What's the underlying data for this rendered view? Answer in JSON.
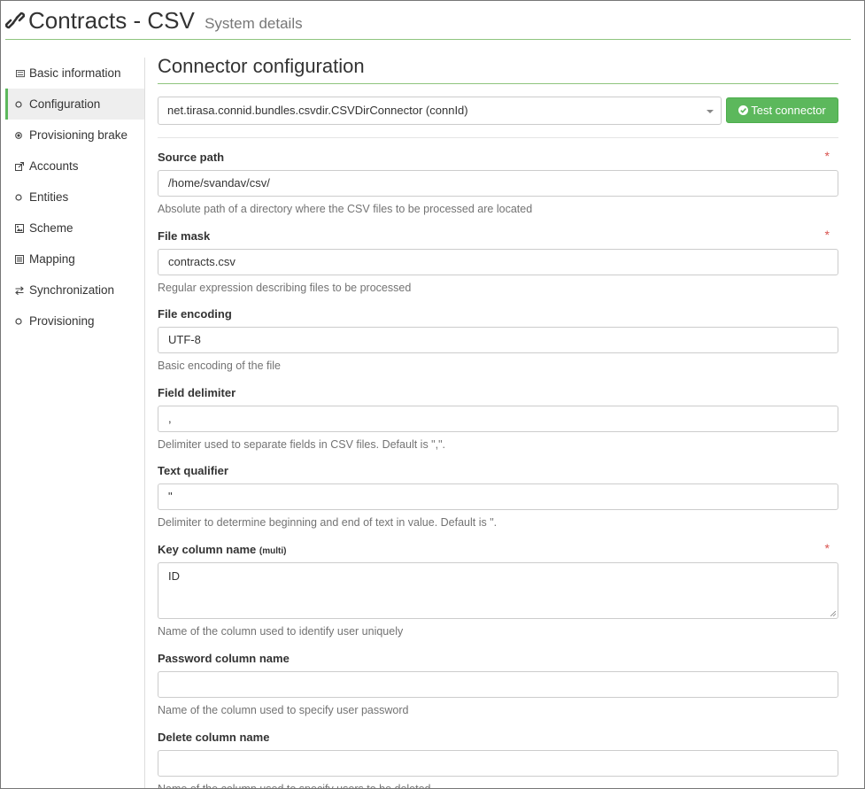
{
  "header": {
    "title": "Contracts - CSV",
    "subtitle": "System details"
  },
  "sidebar": {
    "items": [
      {
        "label": "Basic information",
        "icon": "list-icon",
        "active": false
      },
      {
        "label": "Configuration",
        "icon": "circle-icon",
        "active": true
      },
      {
        "label": "Provisioning brake",
        "icon": "record-icon",
        "active": false
      },
      {
        "label": "Accounts",
        "icon": "external-link-icon",
        "active": false
      },
      {
        "label": "Entities",
        "icon": "circle-icon",
        "active": false
      },
      {
        "label": "Scheme",
        "icon": "picture-icon",
        "active": false
      },
      {
        "label": "Mapping",
        "icon": "list-alt-icon",
        "active": false
      },
      {
        "label": "Synchronization",
        "icon": "transfer-icon",
        "active": false
      },
      {
        "label": "Provisioning",
        "icon": "circle-icon",
        "active": false
      }
    ]
  },
  "main": {
    "title": "Connector configuration",
    "connector_select": "net.tirasa.connid.bundles.csvdir.CSVDirConnector (connId)",
    "test_button": "Test connector",
    "fields": [
      {
        "label": "Source path",
        "value": "/home/svandav/csv/",
        "help": "Absolute path of a directory where the CSV files to be processed are located",
        "required": "*"
      },
      {
        "label": "File mask",
        "value": "contracts.csv",
        "help": "Regular expression describing files to be processed",
        "required": "*"
      },
      {
        "label": "File encoding",
        "value": "UTF-8",
        "help": "Basic encoding of the file"
      },
      {
        "label": "Field delimiter",
        "value": ",",
        "help": "Delimiter used to separate fields in CSV files. Default is \",\"."
      },
      {
        "label": "Text qualifier",
        "value": "\"",
        "help": "Delimiter to determine beginning and end of text in value. Default is \"."
      },
      {
        "label": "Key column name",
        "label_suffix": "(multi)",
        "value": "ID",
        "help": "Name of the column used to identify user uniquely",
        "required": "*"
      },
      {
        "label": "Password column name",
        "value": "",
        "help": "Name of the column used to specify user password"
      },
      {
        "label": "Delete column name",
        "value": "",
        "help": "Name of the column used to specify users to be deleted"
      }
    ]
  },
  "colors": {
    "accent_green": "#5cb85c",
    "header_rule": "#8fc47e",
    "required_red": "#d9534f"
  }
}
